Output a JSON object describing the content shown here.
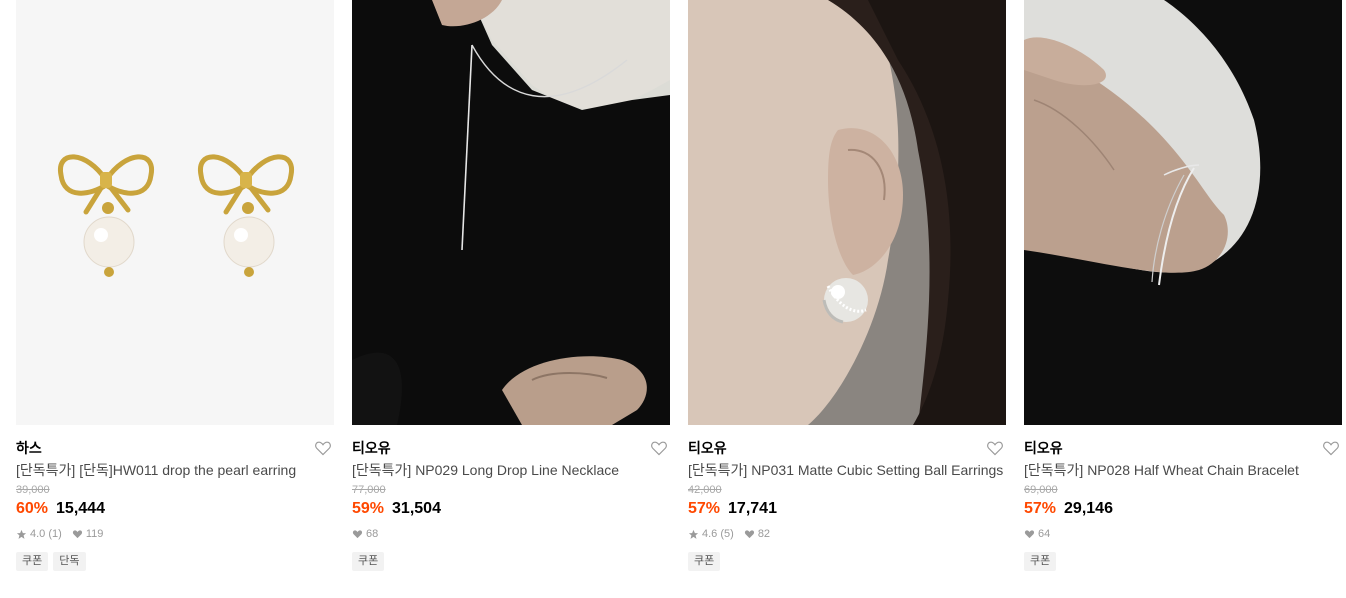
{
  "products": [
    {
      "brand": "하스",
      "title": "[단독특가] [단독]HW011 drop the pearl earring",
      "original_price": "39,000",
      "discount": "60%",
      "price": "15,444",
      "rating": "4.0",
      "review_count": "(1)",
      "likes": "119",
      "tags": [
        "쿠폰",
        "단독"
      ],
      "image": "gold-bow-pearl-earrings"
    },
    {
      "brand": "티오유",
      "title": "[단독특가] NP029 Long Drop Line Necklace",
      "original_price": "77,000",
      "discount": "59%",
      "price": "31,504",
      "likes": "68",
      "tags": [
        "쿠폰"
      ],
      "image": "model-wearing-long-drop-necklace"
    },
    {
      "brand": "티오유",
      "title": "[단독특가] NP031 Matte Cubic Setting Ball Earrings",
      "original_price": "42,000",
      "discount": "57%",
      "price": "17,741",
      "rating": "4.6",
      "review_count": "(5)",
      "likes": "82",
      "tags": [
        "쿠폰"
      ],
      "image": "model-ear-ball-earring"
    },
    {
      "brand": "티오유",
      "title": "[단독특가] NP028 Half Wheat Chain Bracelet",
      "original_price": "69,000",
      "discount": "57%",
      "price": "29,146",
      "likes": "64",
      "tags": [
        "쿠폰"
      ],
      "image": "model-wrist-chain-bracelet"
    }
  ],
  "colors": {
    "discount": "#ff4800",
    "original_price": "#a8a8a8",
    "meta": "#9a9a9a",
    "tag_bg": "#f2f2f2"
  }
}
